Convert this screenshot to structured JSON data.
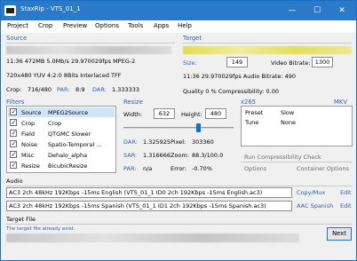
{
  "window": {
    "title": "StaxRip - VTS_01_1",
    "icon": "staxrip-app-icon",
    "controls": {
      "minimize": "—",
      "maximize": "☐",
      "close": "✕"
    }
  },
  "menu": [
    "Project",
    "Crop",
    "Preview",
    "Options",
    "Tools",
    "Apps",
    "Help"
  ],
  "source": {
    "header": "Source",
    "line1": "11:36  472MB  5.0Mb/s  29.970029fps  MPEG-2",
    "line2": "720x480  YUV  4:2:0  8Bits  Interlaced  TFF",
    "crop_label": "Crop:",
    "crop_value": "716/480",
    "par_label": "PAR:",
    "par_value": "8:9",
    "dar_label": "DAR:",
    "dar_value": "1.333333"
  },
  "target": {
    "header": "Target",
    "size_label": "Size:",
    "size_value": "149",
    "bitrate_label": "Video Bitrate:",
    "bitrate_value": "1300",
    "line2": "11:36  29.970029fps  Audio Bitrate: 490",
    "quality": "Quality 0 %   Compressibility: 0.00"
  },
  "filters": {
    "header": "Filters",
    "items": [
      {
        "name": "Source",
        "value": "MPEG2Source",
        "checked": true
      },
      {
        "name": "Crop",
        "value": "Crop",
        "checked": true
      },
      {
        "name": "Field",
        "value": "QTGMC Slower",
        "checked": true
      },
      {
        "name": "Noise",
        "value": "Spatio-Temporal ...",
        "checked": true
      },
      {
        "name": "Misc",
        "value": "Dehalo_alpha",
        "checked": true
      },
      {
        "name": "Resize",
        "value": "BicubicResize",
        "checked": true
      }
    ]
  },
  "resize": {
    "header": "Resize",
    "width_label": "Width:",
    "width_value": "632",
    "height_label": "Height:",
    "height_value": "480",
    "slider_level": 0.68,
    "dar": "DAR:",
    "dar_value": "1.325925",
    "pixel": "Pixel:",
    "pixel_value": "303360",
    "sar": "SAR:",
    "sar_value": "1.316666",
    "zoom": "Zoom:",
    "zoom_value": "88.3/100.0",
    "par": "PAR:",
    "par_value": "n/a",
    "error": "Error:",
    "error_value": "-0.70%"
  },
  "x265": {
    "header": "x265",
    "format": "MKV",
    "preset_label": "Preset",
    "preset_value": "Slow",
    "tune_label": "Tune",
    "tune_value": "None",
    "run_check": "Run Compressibility Check",
    "options": "Options",
    "container_options": "Container Options"
  },
  "audio": {
    "header": "Audio",
    "tracks": [
      {
        "value": "AC3 2ch 48kHz 192Kbps -15ms English (VTS_01_1 ID0 2ch 192Kbps -15ms English.ac3)",
        "codec": "Copy/Mux",
        "edit": "Edit"
      },
      {
        "value": "AC3 2ch 48kHz 192Kbps -15ms Spanish (VTS_01_1 ID1 2ch 192Kbps -15ms Spanish.ac3)",
        "codec": "AAC Spanish",
        "edit": "Edit"
      }
    ]
  },
  "target_file": {
    "header": "Target File",
    "status": "The target file already exist.",
    "next": "Next"
  }
}
